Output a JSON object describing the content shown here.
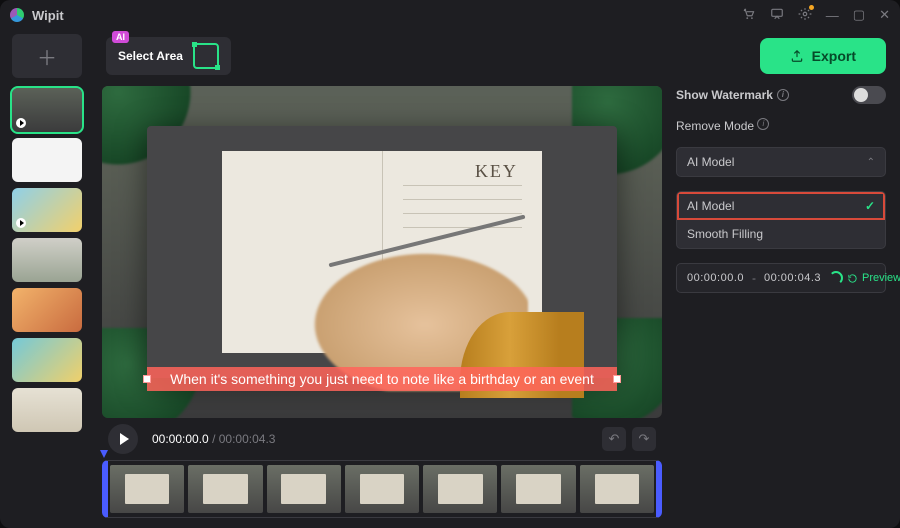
{
  "app": {
    "name": "Wipit"
  },
  "toolbar": {
    "ai_pill": "AI",
    "select_area": "Select Area",
    "export": "Export"
  },
  "preview": {
    "notebook_title": "KEY",
    "caption": "When it's something you just need to note like a birthday or an event"
  },
  "transport": {
    "current": "00:00:00.0",
    "duration": "00:00:04.3"
  },
  "panel": {
    "show_watermark": "Show Watermark",
    "remove_mode": "Remove Mode",
    "selected": "AI Model",
    "options": [
      "AI Model",
      "Smooth Filling"
    ],
    "range_start": "00:00:00.0",
    "range_sep": "-",
    "range_end": "00:00:04.3",
    "preview": "Preview"
  },
  "colors": {
    "accent": "#29e388",
    "highlight": "#d84a3a"
  }
}
